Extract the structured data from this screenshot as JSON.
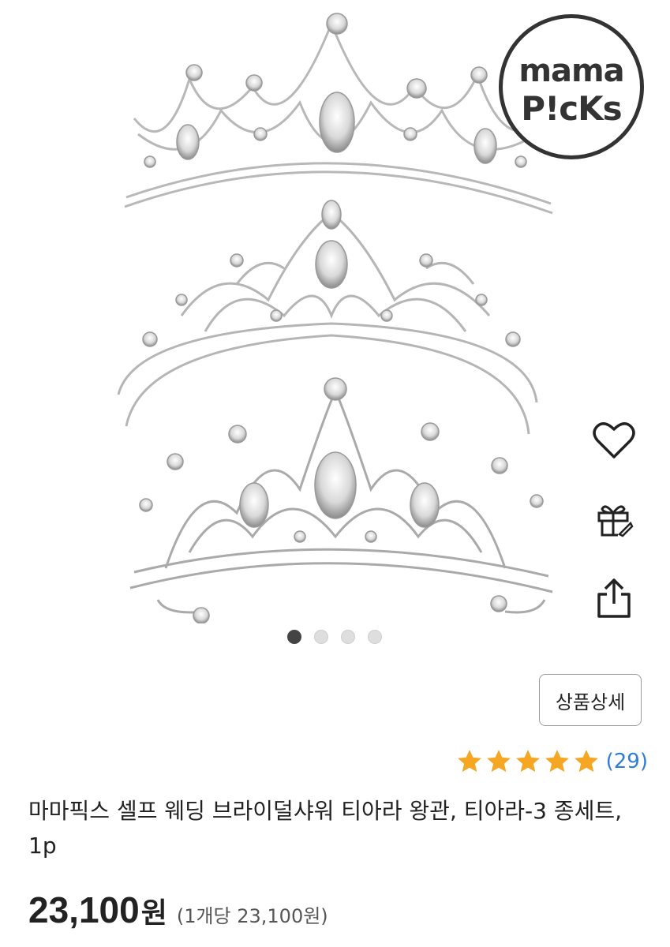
{
  "brand_badge": {
    "line1": "mama",
    "line2": "P!cKs"
  },
  "product": {
    "title": "마마픽스 셀프 웨딩 브라이덜샤워 티아라 왕관, 티아라-3 종세트, 1p",
    "price": "23,100",
    "price_unit": "원",
    "unit_price": "(1개당 23,100원)",
    "rating": 5,
    "review_count": "(29)"
  },
  "buttons": {
    "detail_label": "상품상세"
  },
  "carousel": {
    "total": 4,
    "active": 1
  },
  "icons": {
    "wishlist": "heart-icon",
    "gift": "gift-icon",
    "share": "share-icon",
    "star": "star-icon"
  },
  "colors": {
    "star": "#f5a623",
    "review_link": "#2e7dd7",
    "active_dot": "#444444"
  }
}
